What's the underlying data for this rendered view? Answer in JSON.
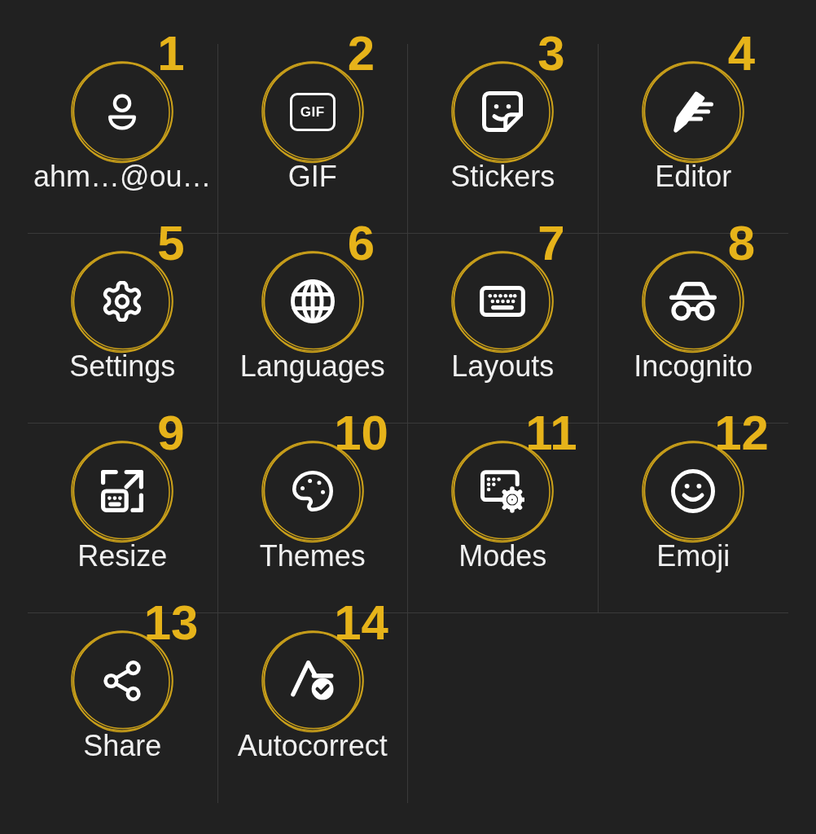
{
  "menu": {
    "items": [
      {
        "label": "ahm…@ou…",
        "annotation_number": "1"
      },
      {
        "label": "GIF",
        "icon_text": "GIF",
        "annotation_number": "2"
      },
      {
        "label": "Stickers",
        "annotation_number": "3"
      },
      {
        "label": "Editor",
        "annotation_number": "4"
      },
      {
        "label": "Settings",
        "annotation_number": "5"
      },
      {
        "label": "Languages",
        "annotation_number": "6"
      },
      {
        "label": "Layouts",
        "annotation_number": "7"
      },
      {
        "label": "Incognito",
        "annotation_number": "8"
      },
      {
        "label": "Resize",
        "annotation_number": "9"
      },
      {
        "label": "Themes",
        "annotation_number": "10"
      },
      {
        "label": "Modes",
        "annotation_number": "11"
      },
      {
        "label": "Emoji",
        "annotation_number": "12"
      },
      {
        "label": "Share",
        "annotation_number": "13"
      },
      {
        "label": "Autocorrect",
        "annotation_number": "14"
      }
    ]
  }
}
